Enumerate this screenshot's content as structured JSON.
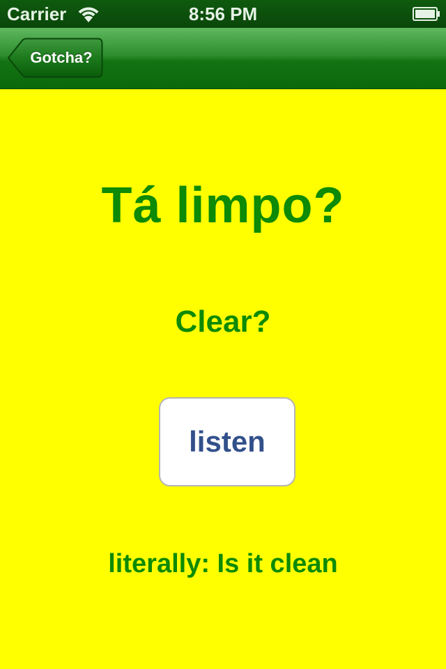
{
  "status_bar": {
    "carrier": "Carrier",
    "time": "8:56 PM",
    "wifi_icon": "wifi-icon",
    "battery_icon": "battery-icon"
  },
  "nav_bar": {
    "back_label": "Gotcha?"
  },
  "card": {
    "phrase": "Tá limpo?",
    "translation": "Clear?",
    "listen_label": "listen",
    "literal": "literally: Is it clean"
  },
  "colors": {
    "background": "#ffff00",
    "text_green": "#0d8a06",
    "nav_green": "#137313",
    "button_text": "#32508a"
  }
}
